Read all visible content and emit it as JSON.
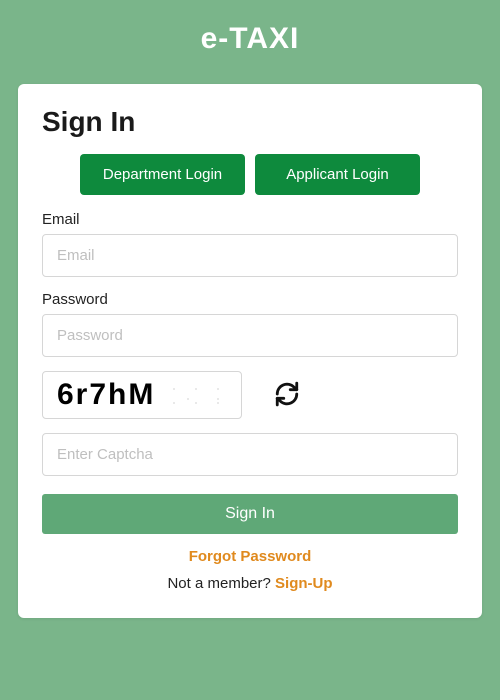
{
  "header": {
    "title": "e-TAXI"
  },
  "card": {
    "title": "Sign In",
    "tabs": {
      "department": "Department Login",
      "applicant": "Applicant Login"
    },
    "email": {
      "label": "Email",
      "placeholder": "Email",
      "value": ""
    },
    "password": {
      "label": "Password",
      "placeholder": "Password",
      "value": ""
    },
    "captcha": {
      "image_text": "6r7hM",
      "placeholder": "Enter Captcha",
      "value": ""
    },
    "submit_label": "Sign In",
    "forgot_label": "Forgot Password",
    "not_member_text": "Not a member? ",
    "signup_label": "Sign-Up"
  }
}
